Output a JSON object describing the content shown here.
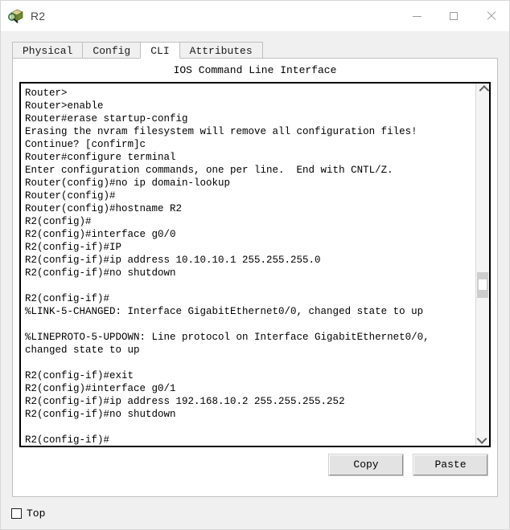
{
  "window": {
    "title": "R2",
    "icon": "router-device-icon",
    "controls": {
      "minimize": "—",
      "maximize": "□",
      "close": "✕"
    }
  },
  "tabs": [
    {
      "label": "Physical",
      "selected": false
    },
    {
      "label": "Config",
      "selected": false
    },
    {
      "label": "CLI",
      "selected": true
    },
    {
      "label": "Attributes",
      "selected": false
    }
  ],
  "panel": {
    "heading": "IOS Command Line Interface"
  },
  "terminal": {
    "lines": [
      "Router>",
      "Router>enable",
      "Router#erase startup-config",
      "Erasing the nvram filesystem will remove all configuration files!",
      "Continue? [confirm]c",
      "Router#configure terminal",
      "Enter configuration commands, one per line.  End with CNTL/Z.",
      "Router(config)#no ip domain-lookup",
      "Router(config)#",
      "Router(config)#hostname R2",
      "R2(config)#",
      "R2(config)#interface g0/0",
      "R2(config-if)#IP",
      "R2(config-if)#ip address 10.10.10.1 255.255.255.0",
      "R2(config-if)#no shutdown",
      "",
      "R2(config-if)#",
      "%LINK-5-CHANGED: Interface GigabitEthernet0/0, changed state to up",
      "",
      "%LINEPROTO-5-UPDOWN: Line protocol on Interface GigabitEthernet0/0,",
      "changed state to up",
      "",
      "R2(config-if)#exit",
      "R2(config)#interface g0/1",
      "R2(config-if)#ip address 192.168.10.2 255.255.255.252",
      "R2(config-if)#no shutdown",
      "",
      "R2(config-if)#"
    ]
  },
  "scrollbar": {
    "up_arrow": "scroll-up-arrow-icon",
    "down_arrow": "scroll-down-arrow-icon"
  },
  "actions": {
    "copy_label": "Copy",
    "paste_label": "Paste"
  },
  "footer": {
    "top_label": "Top",
    "top_checked": false
  }
}
